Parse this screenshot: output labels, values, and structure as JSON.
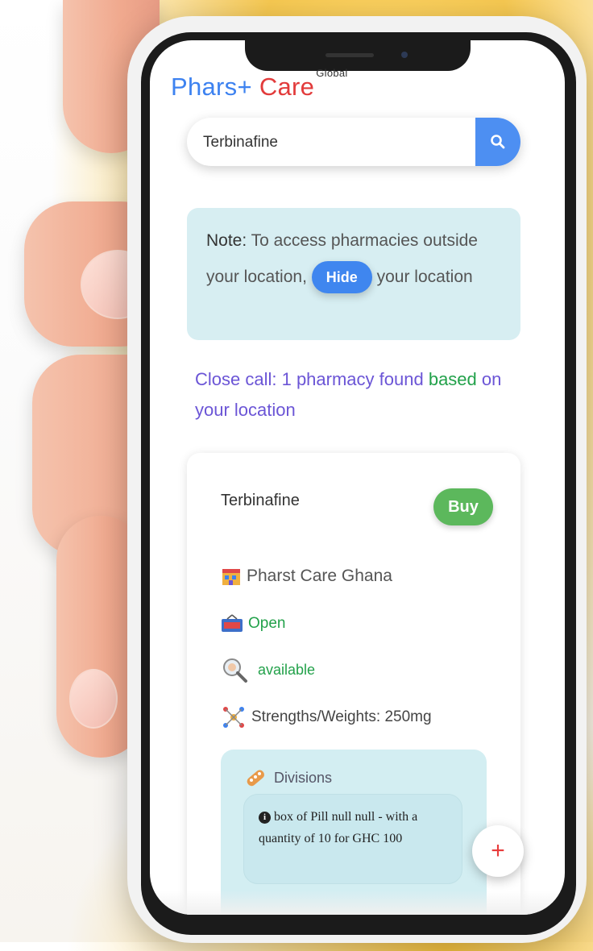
{
  "brand": {
    "part1": "Phars+",
    "part2": "Care",
    "sup": "Global"
  },
  "search": {
    "value": "Terbinafine",
    "placeholder": "Search medicine"
  },
  "note": {
    "label": "Note:",
    "text_before": "To access pharmacies outside your location,",
    "hide_button": "Hide",
    "text_after": "your location"
  },
  "results": {
    "part1": "Close call: 1 pharmacy found",
    "part2": "based",
    "part3": "on your location"
  },
  "card": {
    "drug_name": "Terbinafine",
    "buy_label": "Buy",
    "pharmacy_name": "Pharst Care Ghana",
    "status": "Open",
    "availability": "available",
    "strengths": "Strengths/Weights: 250mg",
    "divisions_title": "Divisions",
    "division_detail": "box of Pill null null - with a quantity of 10 for GHC 100"
  },
  "fab": {
    "label": "+"
  },
  "colors": {
    "brand_blue": "#3d82f0",
    "brand_red": "#e23b3b",
    "buy_green": "#5cb85c",
    "accent_blue": "#4d8ff2"
  }
}
